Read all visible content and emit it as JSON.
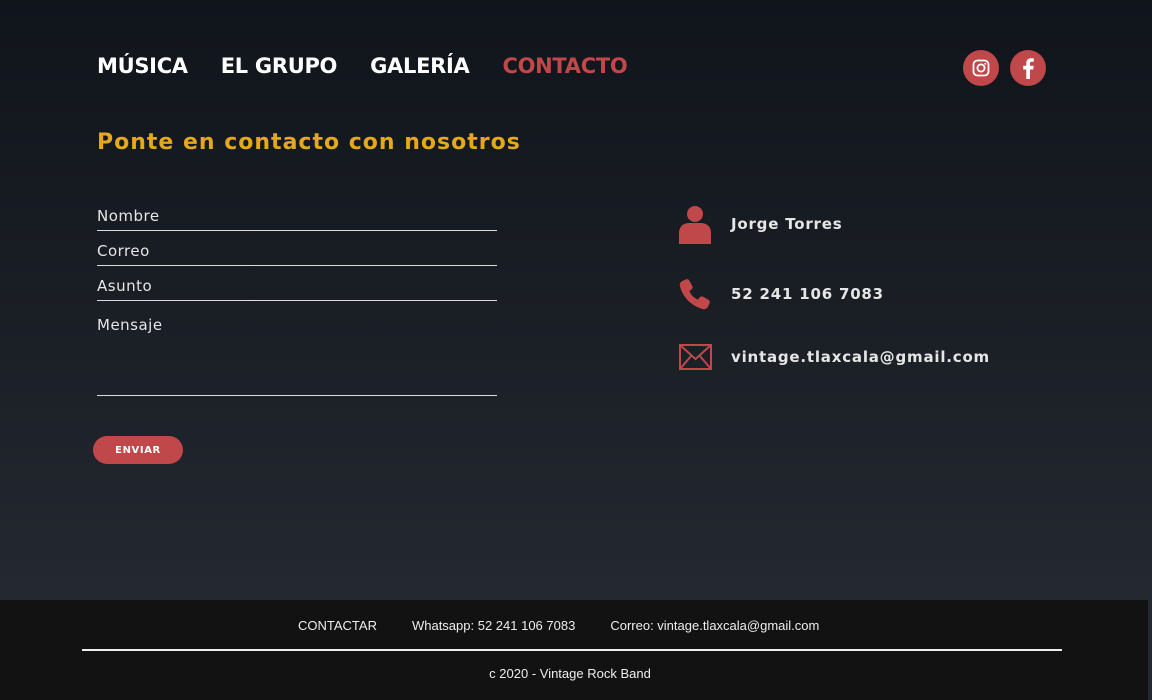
{
  "nav": {
    "items": [
      {
        "label": "MÚSICA",
        "active": false
      },
      {
        "label": "EL GRUPO",
        "active": false
      },
      {
        "label": "GALERÍA",
        "active": false
      },
      {
        "label": "CONTACTO",
        "active": true
      }
    ]
  },
  "social": {
    "instagram_icon": "instagram-icon",
    "facebook_icon": "facebook-icon"
  },
  "heading": "Ponte en contacto con nosotros",
  "form": {
    "name_placeholder": "Nombre",
    "email_placeholder": "Correo",
    "subject_placeholder": "Asunto",
    "message_placeholder": "Mensaje",
    "submit_label": "ENVIAR"
  },
  "contact": {
    "name": "Jorge Torres",
    "phone": "52 241 106 7083",
    "email": "vintage.tlaxcala@gmail.com"
  },
  "footer": {
    "link_contact": "CONTACTAR",
    "whatsapp": "Whatsapp: 52 241 106 7083",
    "email": "Correo:  vintage.tlaxcala@gmail.com",
    "copyright": "c 2020 - Vintage Rock Band"
  },
  "colors": {
    "accent": "#c0474a",
    "heading": "#e3a81b",
    "footer_bg": "#121212"
  }
}
